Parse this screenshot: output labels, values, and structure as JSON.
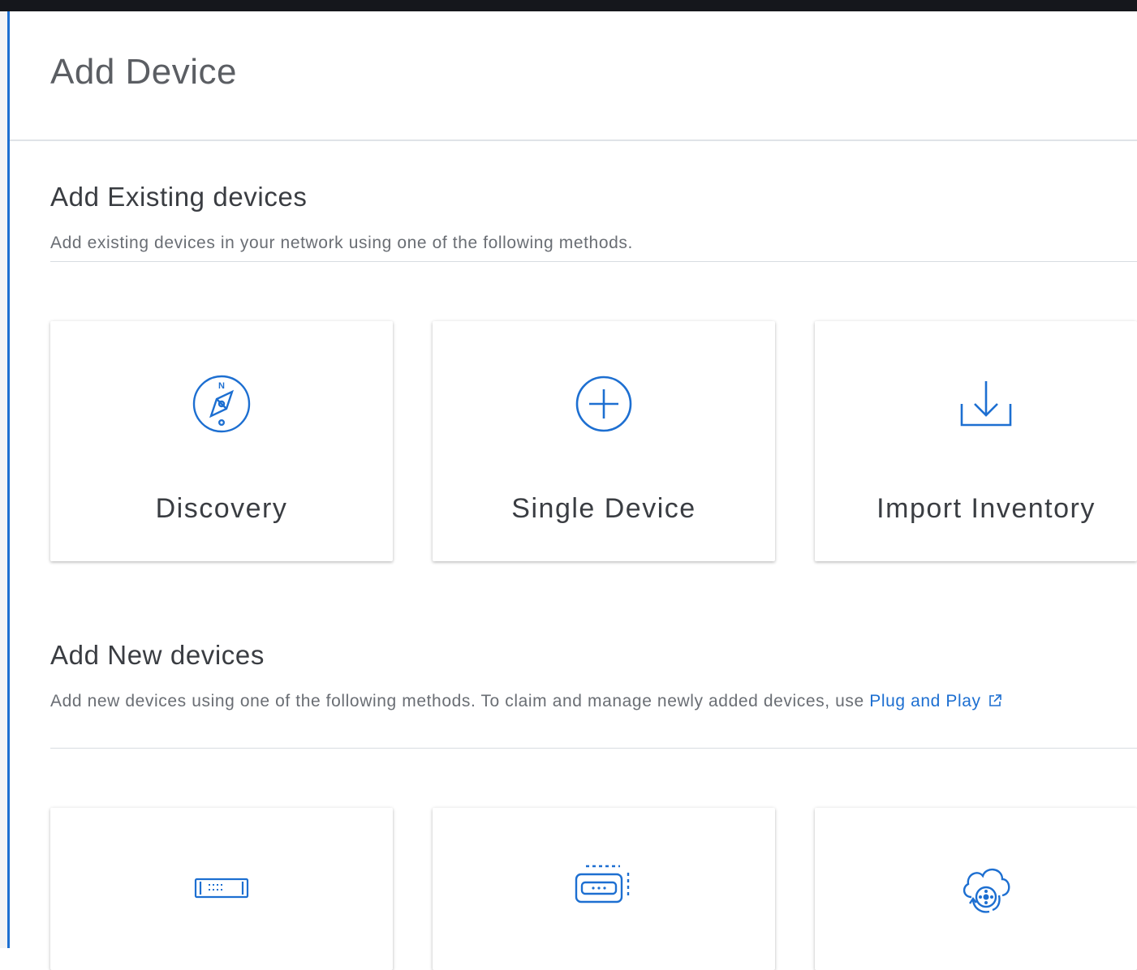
{
  "page": {
    "title": "Add Device"
  },
  "existing": {
    "title": "Add Existing devices",
    "description": "Add existing devices in your network using one of the following methods.",
    "cards": [
      {
        "label": "Discovery",
        "icon": "compass-icon"
      },
      {
        "label": "Single Device",
        "icon": "plus-circle-icon"
      },
      {
        "label": "Import Inventory",
        "icon": "download-icon"
      }
    ]
  },
  "new": {
    "title": "Add New devices",
    "description": "Add new devices using one of the following methods. To claim and manage newly added devices, use ",
    "link_text": "Plug and Play",
    "link_icon": "external-link-icon",
    "cards": [
      {
        "icon": "switch-device-icon"
      },
      {
        "icon": "access-point-icon"
      },
      {
        "icon": "cloud-sync-icon"
      }
    ]
  },
  "colors": {
    "accent": "#1d6fd1",
    "topbar": "#15171c",
    "text_primary": "#3a3d42",
    "text_secondary": "#6a6e74"
  }
}
